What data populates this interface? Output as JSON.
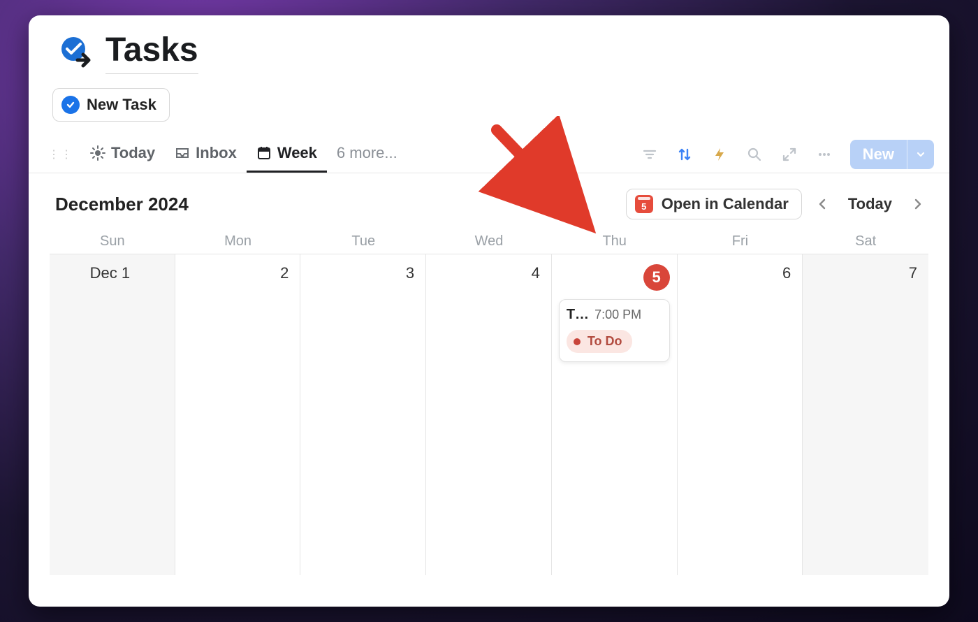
{
  "page": {
    "title": "Tasks",
    "new_task_label": "New Task"
  },
  "tabs": {
    "today": "Today",
    "inbox": "Inbox",
    "week": "Week",
    "more": "6 more..."
  },
  "toolbar": {
    "new_label": "New"
  },
  "calendar": {
    "month_label": "December 2024",
    "open_label": "Open in Calendar",
    "calendar_icon_day": "5",
    "today_label": "Today",
    "daynames": [
      "Sun",
      "Mon",
      "Tue",
      "Wed",
      "Thu",
      "Fri",
      "Sat"
    ],
    "dates": {
      "d0": "Dec 1",
      "d1": "2",
      "d2": "3",
      "d3": "4",
      "d4": "5",
      "d5": "6",
      "d6": "7"
    },
    "today_index": 4
  },
  "event": {
    "title": "T…",
    "time": "7:00 PM",
    "status": "To Do"
  }
}
